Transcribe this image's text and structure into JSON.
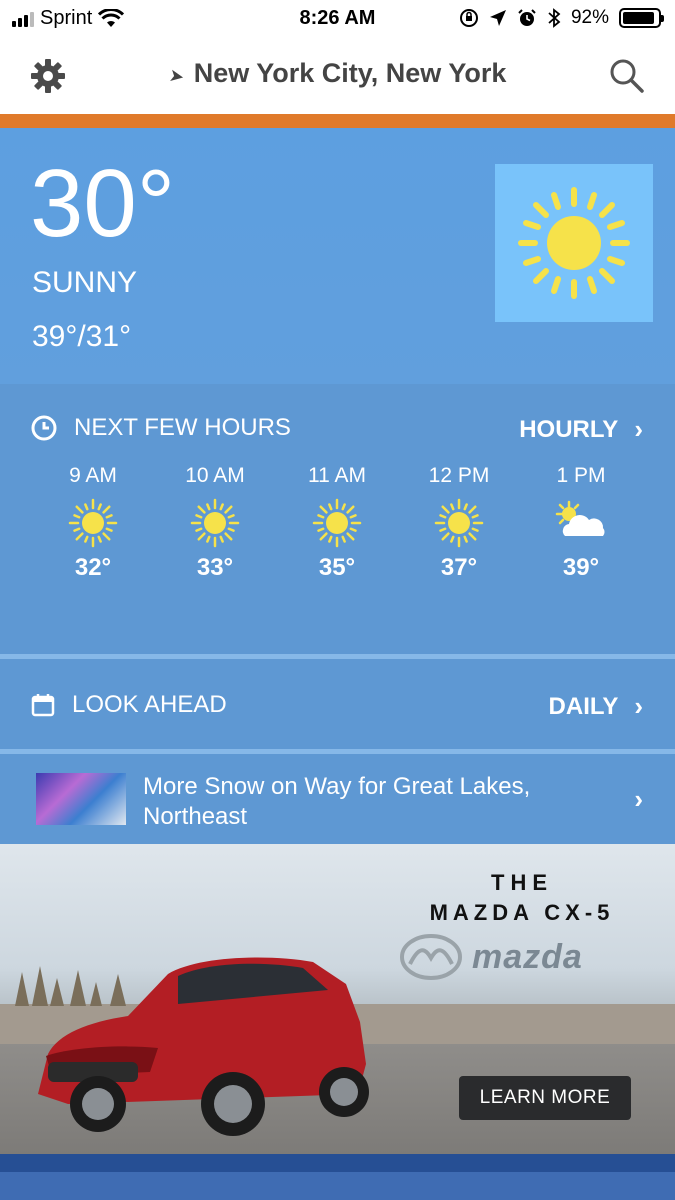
{
  "status_bar": {
    "carrier": "Sprint",
    "time": "8:26 AM",
    "battery_percent": "92%",
    "battery_level": 0.92,
    "icons": [
      "signal-icon",
      "wifi-icon",
      "orientation-lock-icon",
      "location-icon",
      "alarm-icon",
      "bluetooth-icon",
      "battery-icon"
    ]
  },
  "nav": {
    "location": "New York City, New York",
    "icons": [
      "gear-icon",
      "location-arrow-icon",
      "search-icon"
    ]
  },
  "current": {
    "temperature": "30°",
    "condition": "SUNNY",
    "hi_lo": "39°/31°",
    "icon": "sun-icon"
  },
  "hourly": {
    "heading": "NEXT FEW HOURS",
    "link": "HOURLY",
    "items": [
      {
        "time": "9 AM",
        "temp": "32°",
        "icon": "sun-icon"
      },
      {
        "time": "10 AM",
        "temp": "33°",
        "icon": "sun-icon"
      },
      {
        "time": "11 AM",
        "temp": "35°",
        "icon": "sun-icon"
      },
      {
        "time": "12 PM",
        "temp": "37°",
        "icon": "sun-icon"
      },
      {
        "time": "1 PM",
        "temp": "39°",
        "icon": "partly-cloudy-icon"
      }
    ]
  },
  "look_ahead": {
    "heading": "LOOK AHEAD",
    "link": "DAILY"
  },
  "news": {
    "headline": "More Snow on Way for Great Lakes, Northeast"
  },
  "ad": {
    "line1": "THE",
    "line2": "MAZDA CX-5",
    "brand": "mazda",
    "cta": "LEARN MORE"
  },
  "colors": {
    "accent_orange": "#e07a2a",
    "sky_blue": "#5e98d3",
    "sun_yellow": "#f6e24a"
  }
}
